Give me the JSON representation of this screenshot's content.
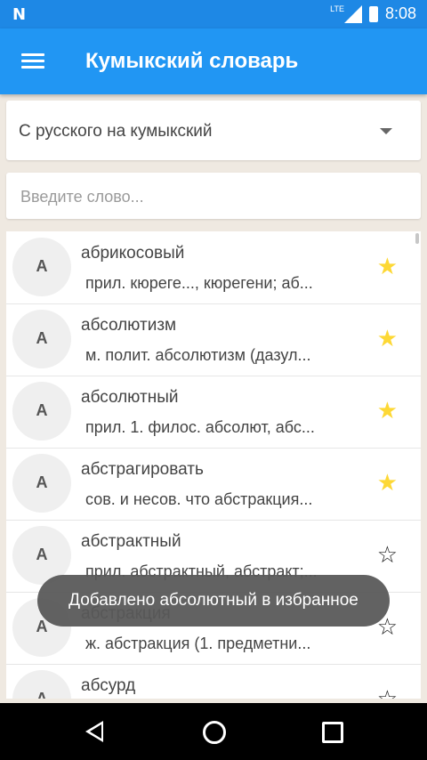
{
  "status_bar": {
    "network": "LTE",
    "battery": "8",
    "time": "8:08"
  },
  "app_bar": {
    "title": "Кумыкский словарь"
  },
  "direction": {
    "selected": "С русского на кумыкский"
  },
  "search": {
    "placeholder": "Введите слово..."
  },
  "entries": [
    {
      "letter": "А",
      "word": "абрикосовый",
      "definition": "прил. кюреге..., кюрегени;  аб...",
      "favorite": true
    },
    {
      "letter": "А",
      "word": "абсолютизм",
      "definition": "м. полит. абсолютизм  (дазул...",
      "favorite": true
    },
    {
      "letter": "А",
      "word": "абсолютный",
      "definition": "прил. 1.  филос. абсолют, абс...",
      "favorite": true
    },
    {
      "letter": "А",
      "word": "абстрагировать",
      "definition": "сов. и несов. что абстракция...",
      "favorite": true
    },
    {
      "letter": "А",
      "word": "абстрактный",
      "definition": "прил. абстрактный, абстракт;...",
      "favorite": false
    },
    {
      "letter": "А",
      "word": "абстракция",
      "definition": "ж. абстракция (1.  предметни...",
      "favorite": false
    },
    {
      "letter": "А",
      "word": "абсурд",
      "definition": "",
      "favorite": false
    }
  ],
  "toast": {
    "message": "Добавлено абсолютный в избранное"
  },
  "icons": {
    "star_on": "★",
    "star_off": "☆"
  },
  "colors": {
    "primary": "#2196f3",
    "status": "#1e88e5",
    "star": "#fdd835"
  }
}
